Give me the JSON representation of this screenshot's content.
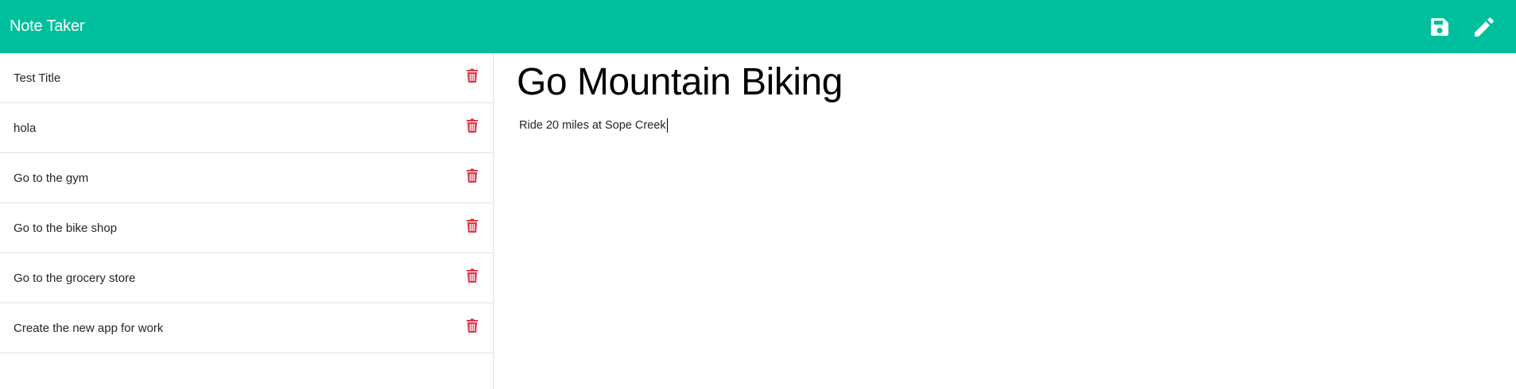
{
  "app": {
    "title": "Note Taker"
  },
  "toolbar": {
    "save_icon": "save-icon",
    "new_icon": "pencil-icon"
  },
  "notes": [
    {
      "title": "Test Title"
    },
    {
      "title": "hola"
    },
    {
      "title": "Go to the gym"
    },
    {
      "title": "Go to the bike shop"
    },
    {
      "title": "Go to the grocery store"
    },
    {
      "title": "Create the new app for work"
    }
  ],
  "active_note": {
    "title": "Go Mountain Biking",
    "text": "Ride 20 miles at Sope Creek"
  },
  "colors": {
    "accent": "#00bf9c",
    "delete": "#dc3545",
    "border": "#dee2e6"
  }
}
